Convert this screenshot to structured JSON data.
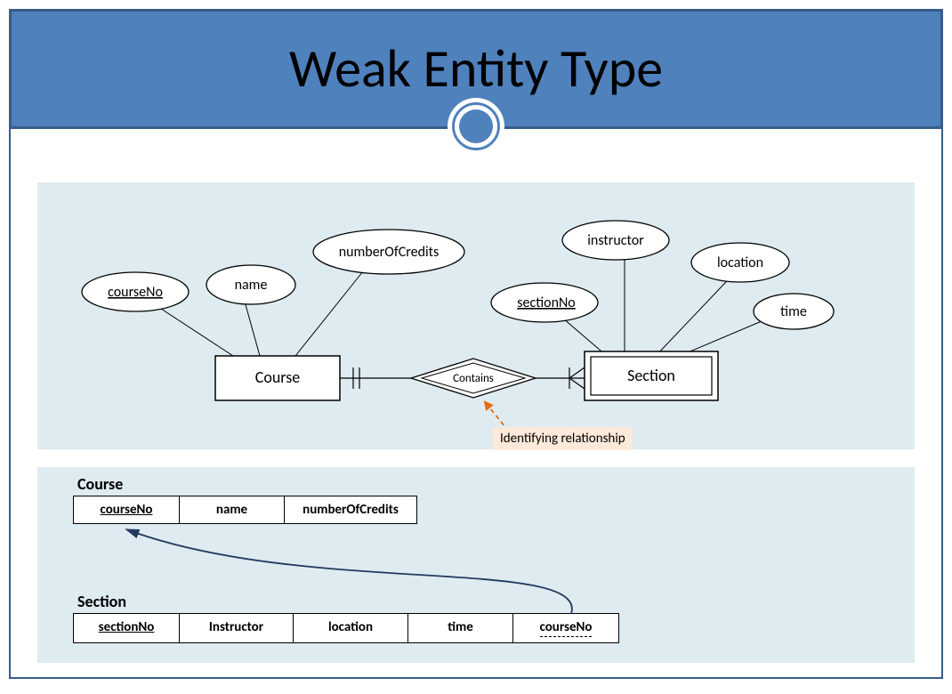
{
  "title": "Weak Entity Type",
  "er": {
    "entity1": "Course",
    "entity2": "Section",
    "relationship": "Contains",
    "attrs_course": {
      "pk": "courseNo",
      "name": "name",
      "credits": "numberOfCredits"
    },
    "attrs_section": {
      "pk": "sectionNo",
      "instructor": "instructor",
      "location": "location",
      "time": "time"
    },
    "annotation": "Identifying relationship"
  },
  "relations": {
    "course": {
      "title": "Course",
      "cols": [
        "courseNo",
        "name",
        "numberOfCredits"
      ]
    },
    "section": {
      "title": "Section",
      "cols": [
        "sectionNo",
        "Instructor",
        "location",
        "time",
        "courseNo"
      ]
    }
  }
}
